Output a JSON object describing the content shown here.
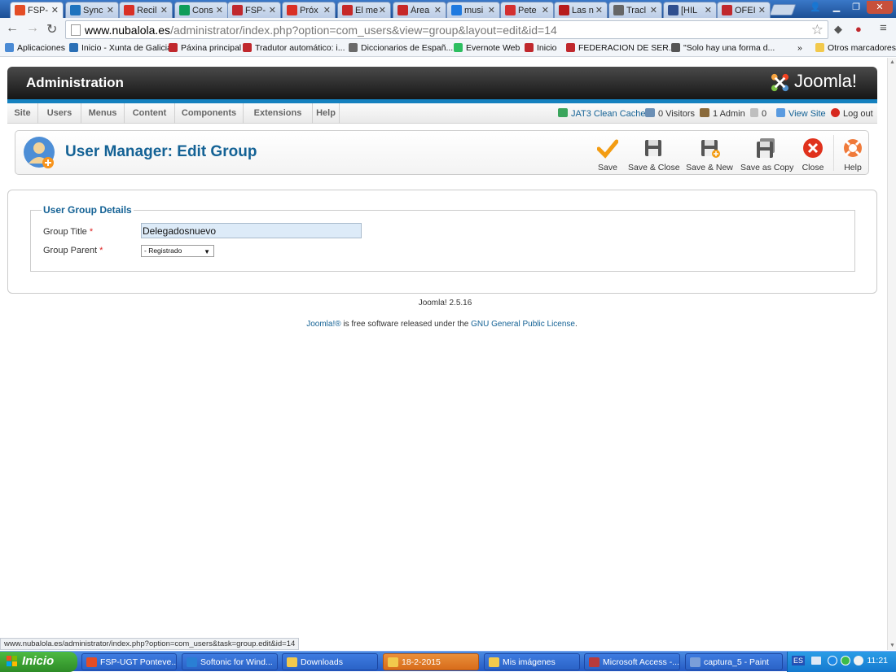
{
  "browser": {
    "tabs": [
      {
        "label": "FSP-",
        "icon": "joomla-icon",
        "color": "#e44d26",
        "active": true
      },
      {
        "label": "Sync",
        "icon": "dsm-icon",
        "color": "#1e73be"
      },
      {
        "label": "Recil",
        "icon": "gmail-icon",
        "color": "#d93025"
      },
      {
        "label": "Cons",
        "icon": "sheets-icon",
        "color": "#0f9d58"
      },
      {
        "label": "FSP-",
        "icon": "ugt-icon",
        "color": "#c0282d"
      },
      {
        "label": "Próx",
        "icon": "gmail-icon",
        "color": "#d93025"
      },
      {
        "label": "El me",
        "icon": "w-icon",
        "color": "#c62828"
      },
      {
        "label": "Área",
        "icon": "w-icon",
        "color": "#c62828"
      },
      {
        "label": "musi",
        "icon": "dropbox-icon",
        "color": "#1f7ae0"
      },
      {
        "label": "Pete",
        "icon": "pdf-icon",
        "color": "#d32f2f"
      },
      {
        "label": "Las n",
        "icon": "acrobat-icon",
        "color": "#b71c1c"
      },
      {
        "label": "Tracl",
        "icon": "tool-icon",
        "color": "#666666"
      },
      {
        "label": "[HIL",
        "icon": "forum-icon",
        "color": "#2f4f8f"
      },
      {
        "label": "OFEI",
        "icon": "ugt-icon",
        "color": "#c0282d"
      }
    ],
    "window_controls": {
      "user": "👤",
      "minimize": "▁",
      "maximize": "❐",
      "close": "✕"
    },
    "url_host": "www.nubalola.es",
    "url_path": "/administrator/index.php?option=com_users&view=group&layout=edit&id=14",
    "bookmarks": [
      {
        "label": "Aplicaciones",
        "color": "#4a8ad4"
      },
      {
        "label": "Inicio - Xunta de Galicia",
        "color": "#2a6fb5"
      },
      {
        "label": "Páxina principal",
        "color": "#c0282d"
      },
      {
        "label": "Tradutor automático: i...",
        "color": "#c0282d"
      },
      {
        "label": "Diccionarios de Españ...",
        "color": "#6a6a6a"
      },
      {
        "label": "Evernote Web",
        "color": "#2dbe60"
      },
      {
        "label": "Inicio",
        "color": "#c0282d"
      },
      {
        "label": "FEDERACION DE SER...",
        "color": "#c0282d"
      },
      {
        "label": "\"Solo hay una forma d...",
        "color": "#555555"
      }
    ],
    "bookmarks_more": "»",
    "other_bookmarks": "Otros marcadores",
    "status_url": "www.nubalola.es/administrator/index.php?option=com_users&task=group.edit&id=14"
  },
  "admin": {
    "header_title": "Administration",
    "logo_text": "Joomla!",
    "menu": [
      "Site",
      "Users",
      "Menus",
      "Content",
      "Components",
      "Extensions",
      "Help"
    ],
    "status": {
      "cache": "JAT3 Clean Cache",
      "visitors": "0 Visitors",
      "admins": "1 Admin",
      "messages": "0",
      "view_site": "View Site",
      "logout": "Log out"
    },
    "page_title": "User Manager: Edit Group",
    "toolbar": {
      "save": "Save",
      "save_close": "Save & Close",
      "save_new": "Save & New",
      "save_copy": "Save as Copy",
      "close": "Close",
      "help": "Help"
    },
    "form": {
      "legend": "User Group Details",
      "title_label": "Group Title",
      "title_value": "Delegadosnuevo",
      "parent_label": "Group Parent",
      "parent_value": "- Registrado",
      "required_mark": "*"
    },
    "footer": {
      "version": "Joomla! 2.5.16",
      "license_link1": "Joomla!®",
      "license_middle": " is free software released under the ",
      "license_link2": "GNU General Public License",
      "license_end": "."
    }
  },
  "taskbar": {
    "start": "Inicio",
    "tasks": [
      {
        "label": "FSP-UGT Ponteve...",
        "color": "#e44d26"
      },
      {
        "label": "Softonic for Wind...",
        "color": "#2a7fd4"
      },
      {
        "label": "Downloads",
        "color": "#f2c94c"
      },
      {
        "label": "18-2-2015",
        "color": "#f2c94c",
        "active": true
      },
      {
        "label": "Mis imágenes",
        "color": "#f2c94c"
      },
      {
        "label": "Microsoft Access -...",
        "color": "#b83b3b"
      },
      {
        "label": "captura_5 - Paint",
        "color": "#7a9fd9"
      }
    ],
    "lang": "ES",
    "clock": "11:21"
  }
}
